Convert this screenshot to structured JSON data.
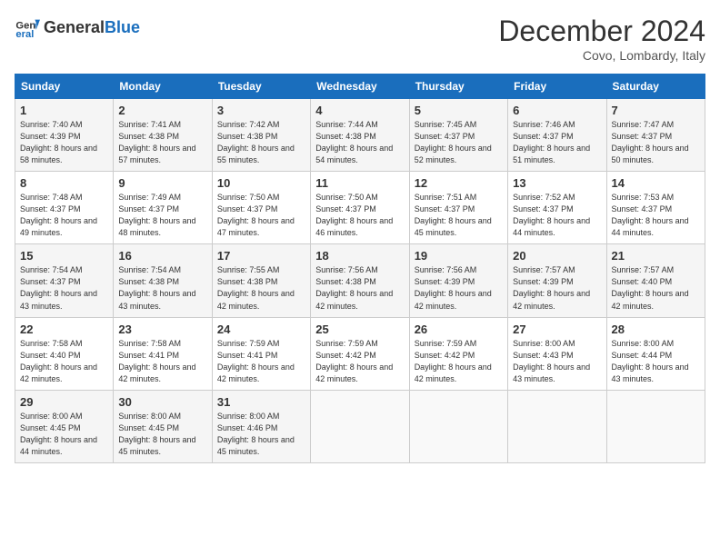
{
  "header": {
    "logo": {
      "general": "General",
      "blue": "Blue"
    },
    "title": "December 2024",
    "subtitle": "Covo, Lombardy, Italy"
  },
  "weekdays": [
    "Sunday",
    "Monday",
    "Tuesday",
    "Wednesday",
    "Thursday",
    "Friday",
    "Saturday"
  ],
  "weeks": [
    [
      {
        "day": "1",
        "sunrise": "7:40 AM",
        "sunset": "4:39 PM",
        "daylight": "8 hours and 58 minutes."
      },
      {
        "day": "2",
        "sunrise": "7:41 AM",
        "sunset": "4:38 PM",
        "daylight": "8 hours and 57 minutes."
      },
      {
        "day": "3",
        "sunrise": "7:42 AM",
        "sunset": "4:38 PM",
        "daylight": "8 hours and 55 minutes."
      },
      {
        "day": "4",
        "sunrise": "7:44 AM",
        "sunset": "4:38 PM",
        "daylight": "8 hours and 54 minutes."
      },
      {
        "day": "5",
        "sunrise": "7:45 AM",
        "sunset": "4:37 PM",
        "daylight": "8 hours and 52 minutes."
      },
      {
        "day": "6",
        "sunrise": "7:46 AM",
        "sunset": "4:37 PM",
        "daylight": "8 hours and 51 minutes."
      },
      {
        "day": "7",
        "sunrise": "7:47 AM",
        "sunset": "4:37 PM",
        "daylight": "8 hours and 50 minutes."
      }
    ],
    [
      {
        "day": "8",
        "sunrise": "7:48 AM",
        "sunset": "4:37 PM",
        "daylight": "8 hours and 49 minutes."
      },
      {
        "day": "9",
        "sunrise": "7:49 AM",
        "sunset": "4:37 PM",
        "daylight": "8 hours and 48 minutes."
      },
      {
        "day": "10",
        "sunrise": "7:50 AM",
        "sunset": "4:37 PM",
        "daylight": "8 hours and 47 minutes."
      },
      {
        "day": "11",
        "sunrise": "7:50 AM",
        "sunset": "4:37 PM",
        "daylight": "8 hours and 46 minutes."
      },
      {
        "day": "12",
        "sunrise": "7:51 AM",
        "sunset": "4:37 PM",
        "daylight": "8 hours and 45 minutes."
      },
      {
        "day": "13",
        "sunrise": "7:52 AM",
        "sunset": "4:37 PM",
        "daylight": "8 hours and 44 minutes."
      },
      {
        "day": "14",
        "sunrise": "7:53 AM",
        "sunset": "4:37 PM",
        "daylight": "8 hours and 44 minutes."
      }
    ],
    [
      {
        "day": "15",
        "sunrise": "7:54 AM",
        "sunset": "4:37 PM",
        "daylight": "8 hours and 43 minutes."
      },
      {
        "day": "16",
        "sunrise": "7:54 AM",
        "sunset": "4:38 PM",
        "daylight": "8 hours and 43 minutes."
      },
      {
        "day": "17",
        "sunrise": "7:55 AM",
        "sunset": "4:38 PM",
        "daylight": "8 hours and 42 minutes."
      },
      {
        "day": "18",
        "sunrise": "7:56 AM",
        "sunset": "4:38 PM",
        "daylight": "8 hours and 42 minutes."
      },
      {
        "day": "19",
        "sunrise": "7:56 AM",
        "sunset": "4:39 PM",
        "daylight": "8 hours and 42 minutes."
      },
      {
        "day": "20",
        "sunrise": "7:57 AM",
        "sunset": "4:39 PM",
        "daylight": "8 hours and 42 minutes."
      },
      {
        "day": "21",
        "sunrise": "7:57 AM",
        "sunset": "4:40 PM",
        "daylight": "8 hours and 42 minutes."
      }
    ],
    [
      {
        "day": "22",
        "sunrise": "7:58 AM",
        "sunset": "4:40 PM",
        "daylight": "8 hours and 42 minutes."
      },
      {
        "day": "23",
        "sunrise": "7:58 AM",
        "sunset": "4:41 PM",
        "daylight": "8 hours and 42 minutes."
      },
      {
        "day": "24",
        "sunrise": "7:59 AM",
        "sunset": "4:41 PM",
        "daylight": "8 hours and 42 minutes."
      },
      {
        "day": "25",
        "sunrise": "7:59 AM",
        "sunset": "4:42 PM",
        "daylight": "8 hours and 42 minutes."
      },
      {
        "day": "26",
        "sunrise": "7:59 AM",
        "sunset": "4:42 PM",
        "daylight": "8 hours and 42 minutes."
      },
      {
        "day": "27",
        "sunrise": "8:00 AM",
        "sunset": "4:43 PM",
        "daylight": "8 hours and 43 minutes."
      },
      {
        "day": "28",
        "sunrise": "8:00 AM",
        "sunset": "4:44 PM",
        "daylight": "8 hours and 43 minutes."
      }
    ],
    [
      {
        "day": "29",
        "sunrise": "8:00 AM",
        "sunset": "4:45 PM",
        "daylight": "8 hours and 44 minutes."
      },
      {
        "day": "30",
        "sunrise": "8:00 AM",
        "sunset": "4:45 PM",
        "daylight": "8 hours and 45 minutes."
      },
      {
        "day": "31",
        "sunrise": "8:00 AM",
        "sunset": "4:46 PM",
        "daylight": "8 hours and 45 minutes."
      },
      null,
      null,
      null,
      null
    ]
  ],
  "labels": {
    "sunrise": "Sunrise:",
    "sunset": "Sunset:",
    "daylight": "Daylight:"
  }
}
